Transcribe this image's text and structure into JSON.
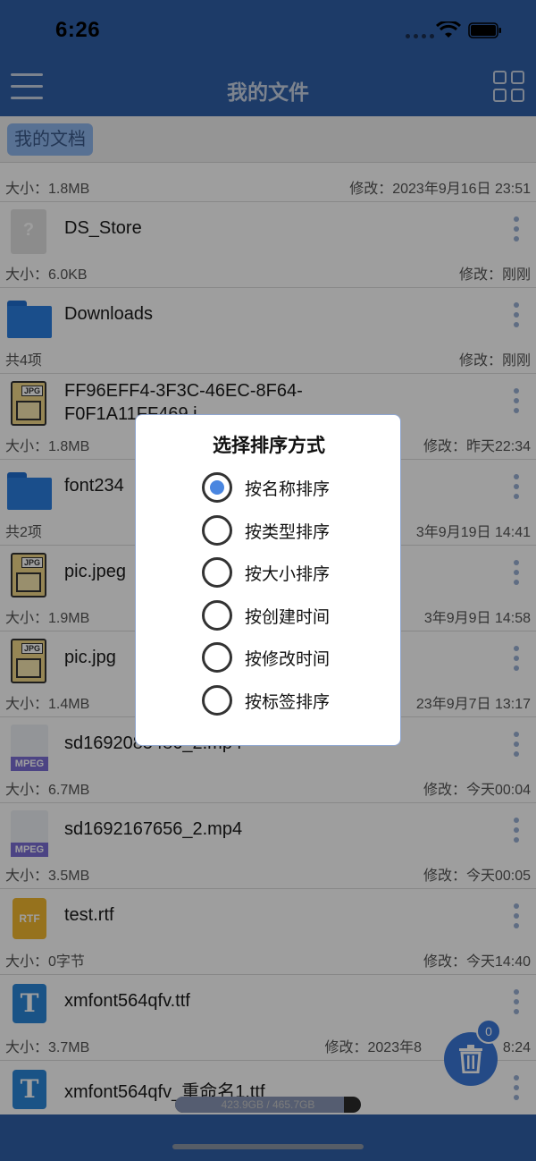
{
  "status": {
    "time": "6:26"
  },
  "header": {
    "title": "我的文件"
  },
  "breadcrumb": {
    "current": "我的文档"
  },
  "partial_row": {
    "size": "大小：1.8MB",
    "modified": "修改：2023年9月16日 23:51"
  },
  "files": [
    {
      "name": "DS_Store",
      "size": "大小：6.0KB",
      "modified": "修改：刚刚",
      "icon": "unknown-file-icon"
    },
    {
      "name": "Downloads",
      "size": "共4项",
      "modified": "修改：刚刚",
      "icon": "folder-icon"
    },
    {
      "name": "FF96EFF4-3F3C-46EC-8F64-F0F1A11FF469.j",
      "size": "大小：1.8MB",
      "modified": "修改：昨天22:34",
      "icon": "jpg-file-icon"
    },
    {
      "name": "font234",
      "size": "共2项",
      "modified": "3年9月19日 14:41",
      "icon": "folder-icon"
    },
    {
      "name": "pic.jpeg",
      "size": "大小：1.9MB",
      "modified": "3年9月9日 14:58",
      "icon": "jpg-file-icon"
    },
    {
      "name": "pic.jpg",
      "size": "大小：1.4MB",
      "modified": "23年9月7日 13:17",
      "icon": "jpg-file-icon"
    },
    {
      "name": "sd1692085486_2.mp4",
      "size": "大小：6.7MB",
      "modified": "修改：今天00:04",
      "icon": "mpeg-file-icon"
    },
    {
      "name": "sd1692167656_2.mp4",
      "size": "大小：3.5MB",
      "modified": "修改：今天00:05",
      "icon": "mpeg-file-icon"
    },
    {
      "name": "test.rtf",
      "size": "大小：0字节",
      "modified": "修改：今天14:40",
      "icon": "rtf-file-icon"
    },
    {
      "name": "xmfont564qfv.ttf",
      "size": "大小：3.7MB",
      "modified": "修改：2023年8",
      "modified_tail": "8:24",
      "icon": "ttf-file-icon"
    },
    {
      "name": "xmfont564qfv_重命名1.ttf",
      "size": "",
      "modified": "",
      "icon": "ttf-file-icon"
    }
  ],
  "icon_labels": {
    "jpg": "JPG",
    "mpeg": "MPEG",
    "rtf": "RTF",
    "ttf": "T",
    "unknown": "?"
  },
  "dialog": {
    "title": "选择排序方式",
    "options": [
      {
        "label": "按名称排序",
        "selected": true
      },
      {
        "label": "按类型排序",
        "selected": false
      },
      {
        "label": "按大小排序",
        "selected": false
      },
      {
        "label": "按创建时间",
        "selected": false
      },
      {
        "label": "按修改时间",
        "selected": false
      },
      {
        "label": "按标签排序",
        "selected": false
      }
    ]
  },
  "storage": {
    "text": "423.9GB / 465.7GB",
    "used_fraction": 0.91
  },
  "trash": {
    "badge": "0"
  },
  "colors": {
    "primary": "#2f5fa8",
    "accent": "#4a86e0",
    "folder": "#2b7fe0"
  }
}
